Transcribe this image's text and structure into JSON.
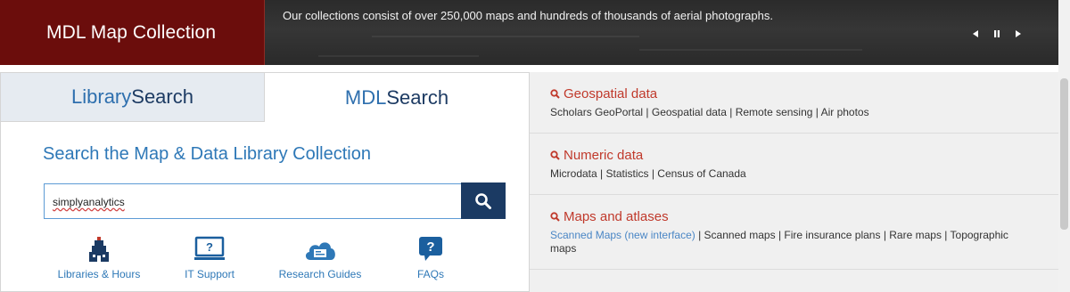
{
  "header": {
    "title": "MDL Map Collection",
    "banner_text": "Our collections consist of over 250,000 maps and hundreds of thousands of aerial photographs."
  },
  "slider": {
    "prev_icon": "previous-icon",
    "pause_icon": "pause-icon",
    "next_icon": "next-icon"
  },
  "search": {
    "tabs": [
      {
        "part1": "Library",
        "part2": "Search"
      },
      {
        "part1": "MDL",
        "part2": "Search"
      }
    ],
    "heading": "Search the Map & Data Library Collection",
    "query": "simplyanalytics",
    "button_icon": "search-icon"
  },
  "quick_links": [
    {
      "label": "Libraries & Hours",
      "icon": "library-building-icon"
    },
    {
      "label": "IT Support",
      "icon": "monitor-question-icon"
    },
    {
      "label": "Research Guides",
      "icon": "cloud-document-icon"
    },
    {
      "label": "FAQs",
      "icon": "question-bubble-icon"
    }
  ],
  "categories": [
    {
      "title": "Geospatial data",
      "links": [
        "Scholars GeoPortal",
        "Geospatial data",
        "Remote sensing",
        "Air photos"
      ]
    },
    {
      "title": "Numeric data",
      "links": [
        "Microdata",
        "Statistics",
        "Census of Canada"
      ]
    },
    {
      "title": "Maps and atlases",
      "links": [
        "Scanned Maps (new interface)",
        "Scanned maps",
        "Fire insurance plans",
        "Rare maps",
        "Topographic maps"
      ]
    }
  ],
  "colors": {
    "brand": "#6b0d0c",
    "accent_blue": "#2e78b7",
    "navy": "#1b3a63",
    "category_red": "#c0392b"
  }
}
